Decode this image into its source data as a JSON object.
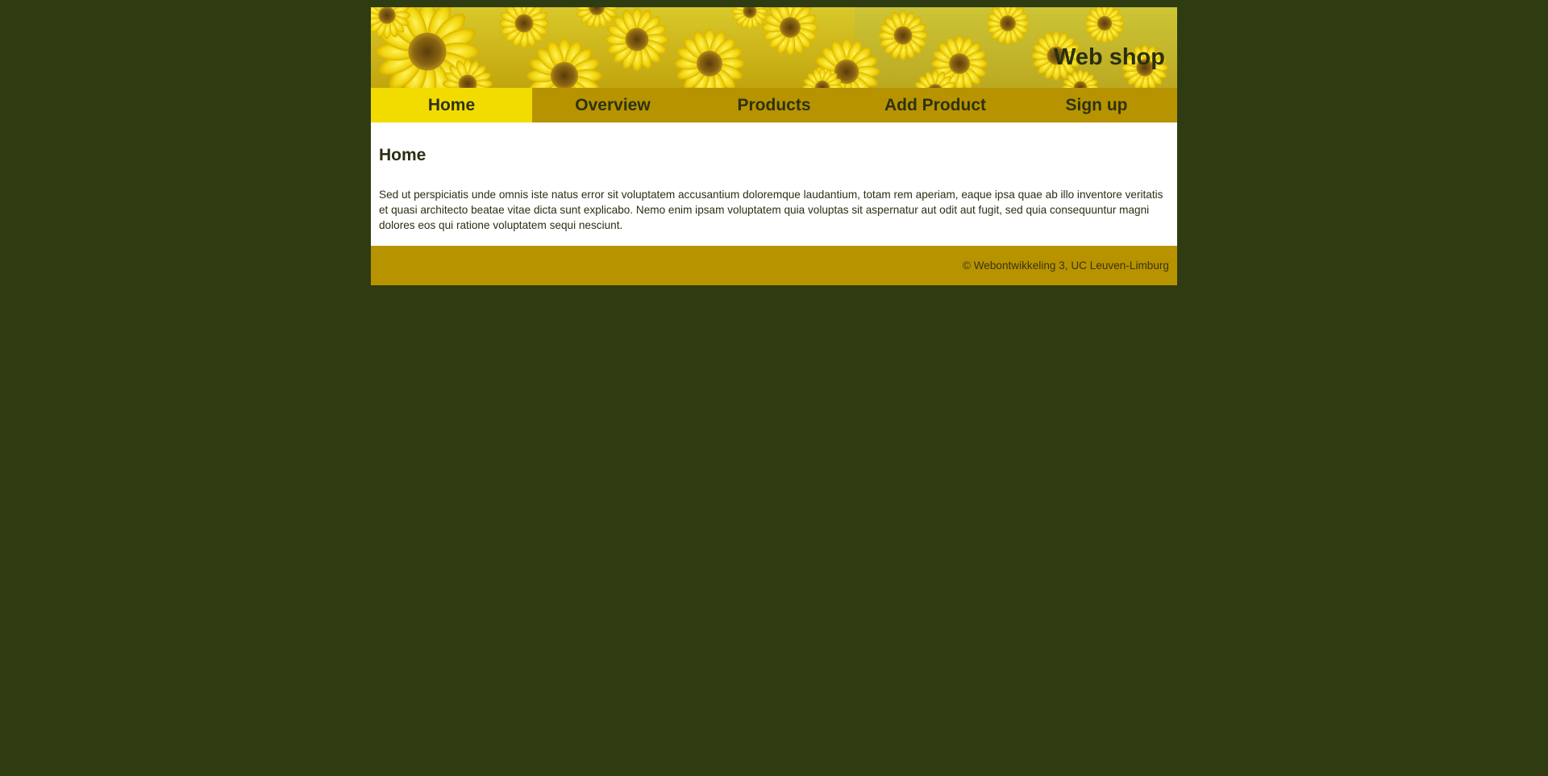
{
  "header": {
    "title": "Web shop",
    "banner_image": "sunflower-field-photo"
  },
  "nav": {
    "items": [
      {
        "label": "Home",
        "active": true
      },
      {
        "label": "Overview",
        "active": false
      },
      {
        "label": "Products",
        "active": false
      },
      {
        "label": "Add Product",
        "active": false
      },
      {
        "label": "Sign up",
        "active": false
      }
    ]
  },
  "main": {
    "heading": "Home",
    "text": "Sed ut perspiciatis unde omnis iste natus error sit voluptatem accusantium doloremque laudantium, totam rem aperiam, eaque ipsa quae ab illo inventore veritatis et quasi architecto beatae vitae dicta sunt explicabo. Nemo enim ipsam voluptatem quia voluptas sit aspernatur aut odit aut fugit, sed quia consequuntur magni dolores eos qui ratione voluptatem sequi nesciunt."
  },
  "footer": {
    "copyright": "© Webontwikkeling 3, UC Leuven-Limburg"
  },
  "colors": {
    "page_background": "#2f3c11",
    "nav_background": "#b89300",
    "nav_active": "#f2dc00",
    "content_background": "#ffffff",
    "text": "#2a2f12"
  }
}
